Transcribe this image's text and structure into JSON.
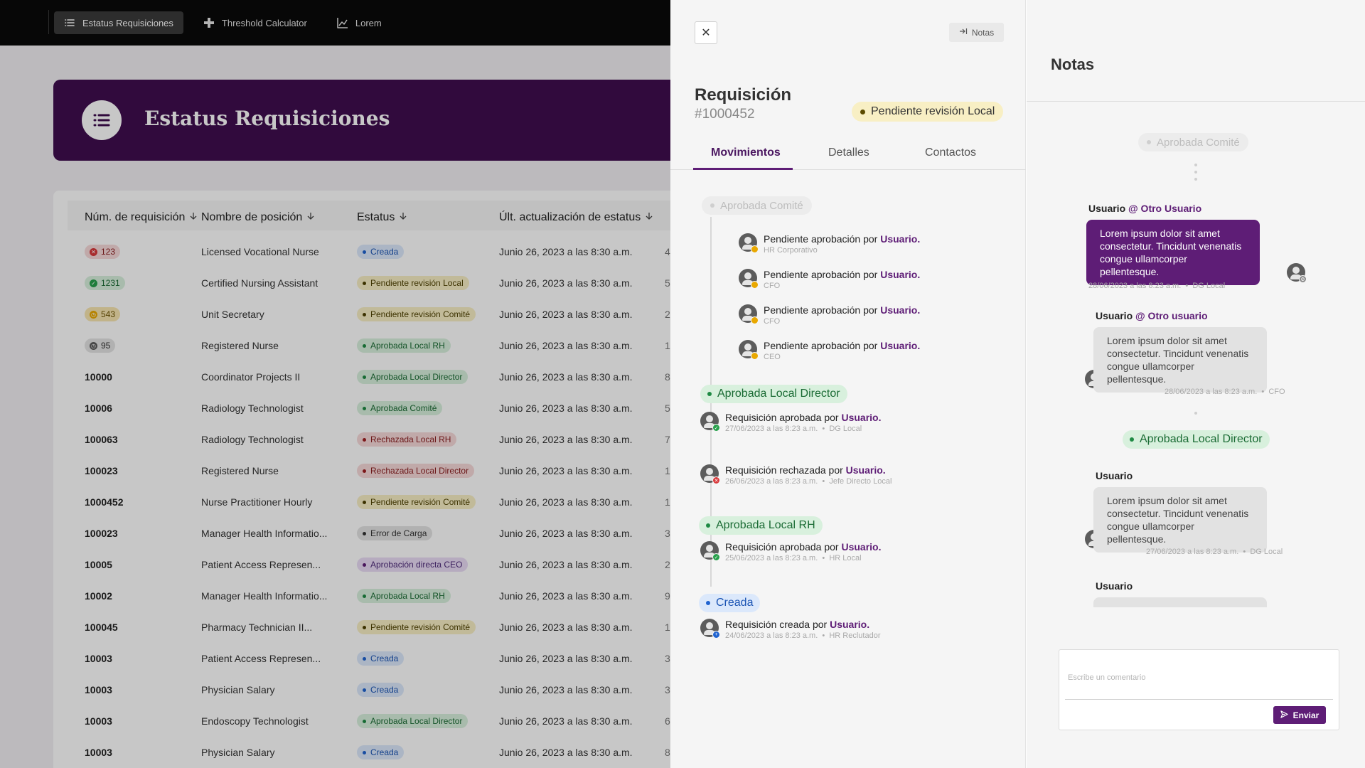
{
  "topnav": {
    "items": [
      {
        "label": "Estatus Requisiciones",
        "icon": "list-icon"
      },
      {
        "label": "Threshold Calculator",
        "icon": "plus-cross-icon"
      },
      {
        "label": "Lorem",
        "icon": "line-chart-icon"
      }
    ]
  },
  "page": {
    "title": "Estatus Requisiciones",
    "icon": "list-icon"
  },
  "table": {
    "headers": [
      "Núm. de requisición",
      "Nombre de posición",
      "Estatus",
      "Últ. actualización de estatus"
    ],
    "rows": [
      {
        "num": "123",
        "num_badge": "error",
        "position": "Licensed Vocational Nurse",
        "status": "Creada",
        "date": "Junio 26, 2023 a las 8:30 a.m.",
        "extra": "4"
      },
      {
        "num": "1231",
        "num_badge": "success",
        "position": "Certified Nursing Assistant",
        "status": "Pendiente revisión Local",
        "date": "Junio 26, 2023 a las 8:30 a.m.",
        "extra": "5"
      },
      {
        "num": "543",
        "num_badge": "warning",
        "position": "Unit Secretary",
        "status": "Pendiente revisión Comité",
        "date": "Junio 26, 2023 a las 8:30 a.m.",
        "extra": "2"
      },
      {
        "num": "95",
        "num_badge": "neutral",
        "position": "Registered Nurse",
        "status": "Aprobada Local RH",
        "date": "Junio 26, 2023 a las 8:30 a.m.",
        "extra": "1"
      },
      {
        "num": "10000",
        "position": "Coordinator Projects II",
        "status": "Aprobada Local Director",
        "date": "Junio 26, 2023 a las 8:30 a.m.",
        "extra": "8"
      },
      {
        "num": "10006",
        "position": "Radiology Technologist",
        "status": "Aprobada Comité",
        "date": "Junio 26, 2023 a las 8:30 a.m.",
        "extra": "5"
      },
      {
        "num": "100063",
        "position": "Radiology Technologist",
        "status": "Rechazada Local RH",
        "date": "Junio 26, 2023 a las 8:30 a.m.",
        "extra": "7"
      },
      {
        "num": "100023",
        "position": "Registered Nurse",
        "status": "Rechazada Local Director",
        "date": "Junio 26, 2023 a las 8:30 a.m.",
        "extra": "1"
      },
      {
        "num": "1000452",
        "position": "Nurse Practitioner Hourly",
        "status": "Pendiente revisión Comité",
        "date": "Junio 26, 2023 a las 8:30 a.m.",
        "extra": "1"
      },
      {
        "num": "100023",
        "position": "Manager Health Informatio...",
        "status": "Error de Carga",
        "date": "Junio 26, 2023 a las 8:30 a.m.",
        "extra": "3"
      },
      {
        "num": "10005",
        "position": "Patient Access Represen...",
        "status": "Aprobación directa CEO",
        "date": "Junio 26, 2023 a las 8:30 a.m.",
        "extra": "2"
      },
      {
        "num": "10002",
        "position": "Manager Health Informatio...",
        "status": "Aprobada Local RH",
        "date": "Junio 26, 2023 a las 8:30 a.m.",
        "extra": "9"
      },
      {
        "num": "100045",
        "position": "Pharmacy Technician II...",
        "status": "Pendiente revisión Comité",
        "date": "Junio 26, 2023 a las 8:30 a.m.",
        "extra": "1"
      },
      {
        "num": "10003",
        "position": "Patient Access Represen...",
        "status": "Creada",
        "date": "Junio 26, 2023 a las 8:30 a.m.",
        "extra": "3"
      },
      {
        "num": "10003",
        "position": "Physician Salary",
        "status": "Creada",
        "date": "Junio 26, 2023 a las 8:30 a.m.",
        "extra": "3"
      },
      {
        "num": "10003",
        "position": "Endoscopy Technologist",
        "status": "Aprobada Local Director",
        "date": "Junio 26, 2023 a las 8:30 a.m.",
        "extra": "6"
      },
      {
        "num": "10003",
        "position": "Physician Salary",
        "status": "Creada",
        "date": "Junio 26, 2023 a las 8:30 a.m.",
        "extra": "8"
      }
    ]
  },
  "colors": {
    "nav_bg": "#0a0a0a",
    "banner_bg": "#3f0d4f",
    "accent_purple": "#5e1d76",
    "status_blue": "#dbe8fb",
    "status_yellow": "#f8efc4",
    "status_green": "#d8f0dd",
    "status_red": "#f6d9d9",
    "status_gray": "#e3e3e3",
    "status_purple": "#e9dcf5"
  },
  "detail": {
    "close_label": "✕",
    "notas_label": "Notas",
    "title": "Requisición",
    "number": "#1000452",
    "status": "Pendiente revisión Local",
    "tabs": [
      "Movimientos",
      "Detalles",
      "Contactos"
    ],
    "timeline": {
      "ghost": "Aprobada Comité",
      "pending": [
        {
          "text": "Pendiente aprobación por",
          "user": "Usuario.",
          "role": "HR Corporativo"
        },
        {
          "text": "Pendiente aprobación por",
          "user": "Usuario.",
          "role": "CFO"
        },
        {
          "text": "Pendiente aprobación por",
          "user": "Usuario.",
          "role": "CFO"
        },
        {
          "text": "Pendiente aprobación por",
          "user": "Usuario.",
          "role": "CEO"
        }
      ],
      "groups": [
        {
          "label": "Aprobada Local Director",
          "events": [
            {
              "text": "Requisición aprobada por",
              "user": "Usuario.",
              "date": "27/06/2023 a las 8:23 a.m.",
              "role": "DG Local",
              "type": "approved"
            },
            {
              "text": "Requisición rechazada por",
              "user": "Usuario.",
              "date": "26/06/2023 a las 8:23 a.m.",
              "role": "Jefe Directo Local",
              "type": "rejected"
            }
          ]
        },
        {
          "label": "Aprobada Local RH",
          "events": [
            {
              "text": "Requisición aprobada por",
              "user": "Usuario.",
              "date": "25/06/2023 a las 8:23 a.m.",
              "role": "HR Local",
              "type": "approved"
            }
          ]
        },
        {
          "label": "Creada",
          "events": [
            {
              "text": "Requisición creada por",
              "user": "Usuario.",
              "date": "24/06/2023 a las 8:23 a.m.",
              "role": "HR Reclutador",
              "type": "created"
            }
          ]
        }
      ]
    }
  },
  "notes": {
    "title": "Notas",
    "ghost": "Aprobada Comité",
    "group_label": "Aprobada Local Director",
    "items": [
      {
        "author": "Usuario",
        "mention": "@ Otro Usuario",
        "text": "Lorem ipsum dolor sit amet consectetur. Tincidunt venenatis congue ullamcorper pellentesque.",
        "date": "28/06/2023 a las 8:23 a.m.",
        "role": "DG Local"
      },
      {
        "author": "Usuario",
        "mention": "@ Otro usuario",
        "text": "Lorem ipsum dolor sit amet consectetur. Tincidunt venenatis congue ullamcorper pellentesque.",
        "date": "28/06/2023 a las 8:23 a.m.",
        "role": "CFO"
      },
      {
        "author": "Usuario",
        "mention": "",
        "text": "Lorem ipsum dolor sit amet consectetur. Tincidunt venenatis congue ullamcorper pellentesque.",
        "date": "27/06/2023 a las 8:23 a.m.",
        "role": "DG Local"
      },
      {
        "author": "Usuario",
        "mention": "",
        "text": "",
        "date": "",
        "role": ""
      }
    ],
    "comment_placeholder": "Escribe un comentario",
    "send_label": "Enviar"
  }
}
